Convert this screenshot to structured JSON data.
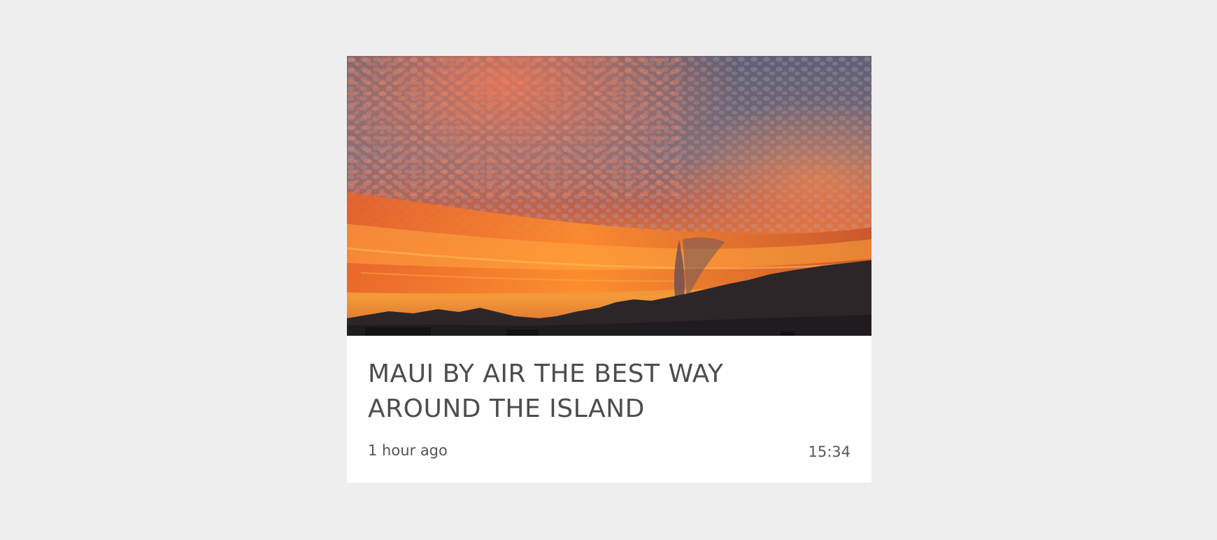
{
  "card": {
    "image": {
      "subject": "sunset-over-mountains"
    },
    "title": "MAUI BY AIR THE BEST WAY AROUND THE ISLAND",
    "age": "1 hour ago",
    "duration": "15:34"
  },
  "colors": {
    "page_background": "#eeeeee",
    "card_background": "#ffffff",
    "text": "#4d4d4d"
  }
}
